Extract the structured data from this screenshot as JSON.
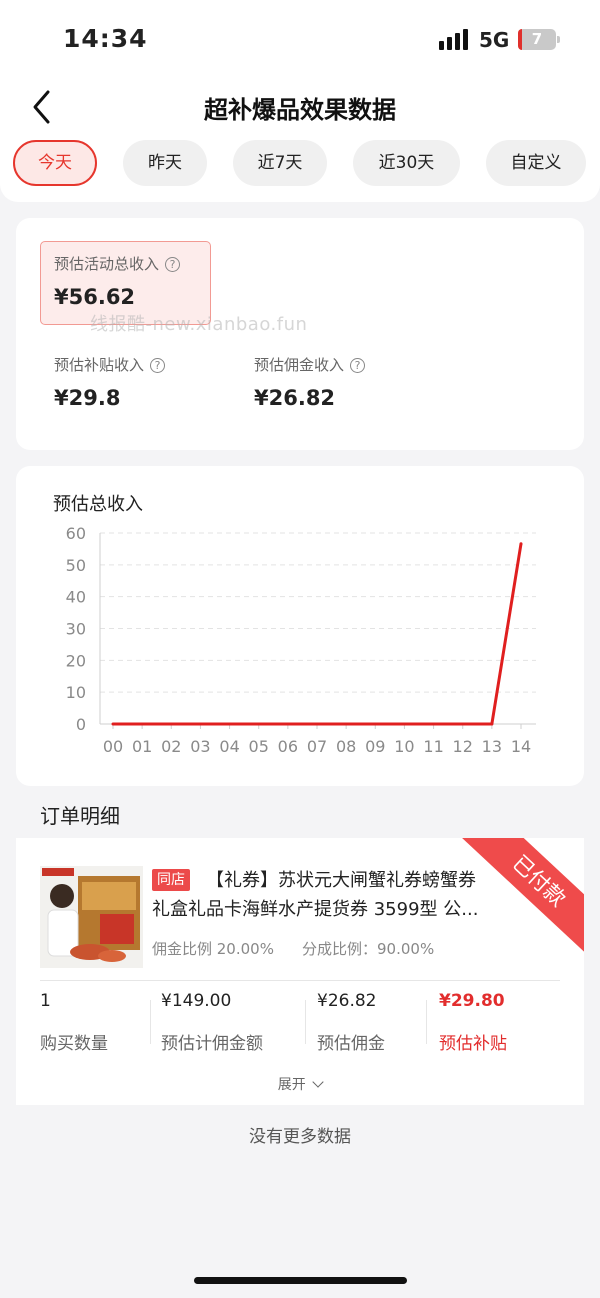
{
  "status": {
    "time": "14:34",
    "network": "5G",
    "battery": "7"
  },
  "nav": {
    "title": "超补爆品效果数据"
  },
  "tabs": [
    {
      "label": "今天",
      "active": true
    },
    {
      "label": "昨天"
    },
    {
      "label": "近7天"
    },
    {
      "label": "近30天"
    },
    {
      "label": "自定义"
    }
  ],
  "summary": {
    "total_label": "预估活动总收入",
    "total_value": "¥56.62",
    "subsidy_label": "预估补贴收入",
    "subsidy_value": "¥29.8",
    "commission_label": "预估佣金收入",
    "commission_value": "¥26.82",
    "help_glyph": "?",
    "watermark": "线报酷-new.xianbao.fun"
  },
  "chart": {
    "title": "预估总收入"
  },
  "chart_data": {
    "type": "line",
    "title": "预估总收入",
    "x": [
      "00",
      "01",
      "02",
      "03",
      "04",
      "05",
      "06",
      "07",
      "08",
      "09",
      "10",
      "11",
      "12",
      "13",
      "14"
    ],
    "series": [
      {
        "values": [
          0,
          0,
          0,
          0,
          0,
          0,
          0,
          0,
          0,
          0,
          0,
          0,
          0,
          0,
          56.62
        ]
      }
    ],
    "ylim": [
      0,
      60
    ],
    "yticks": [
      0,
      10,
      20,
      30,
      40,
      50,
      60
    ],
    "grid": true,
    "line_color": "#e01f1f"
  },
  "orders": {
    "section_title": "订单明细",
    "items": [
      {
        "status": "已付款",
        "tag": "同店",
        "title_line1": "【礼券】苏状元大闸蟹礼券螃蟹券",
        "title_line2": "礼盒礼品卡海鲜水产提货券 3599型 公...",
        "commission_rate": "佣金比例 20.00%",
        "share_rate": "分成比例：90.00%",
        "qty_value": "1",
        "qty_label": "购买数量",
        "base_value": "¥149.00",
        "base_label": "预估计佣金额",
        "commission_value": "¥26.82",
        "commission_label": "预估佣金",
        "subsidy_value": "¥29.80",
        "subsidy_label": "预估补贴",
        "expand_label": "展开"
      }
    ],
    "no_more": "没有更多数据"
  },
  "colors": {
    "accent": "#e6362d",
    "accent_bg": "#fde8e6",
    "page_bg": "#f4f4f6"
  }
}
